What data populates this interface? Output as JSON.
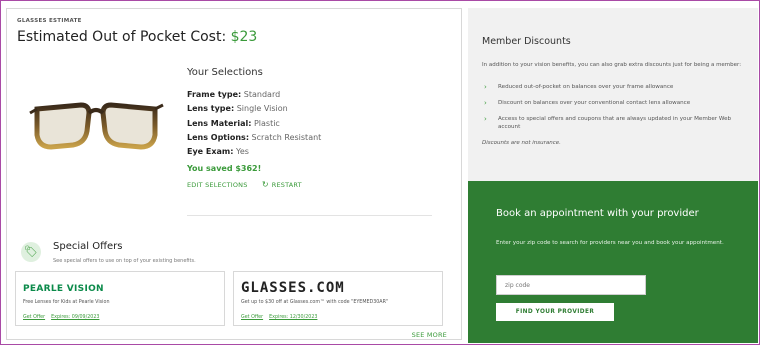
{
  "estimate": {
    "eyebrow": "GLASSES ESTIMATE",
    "title_prefix": "Estimated Out of Pocket Cost: ",
    "price": "$23"
  },
  "selections": {
    "title": "Your Selections",
    "rows": [
      {
        "key": "Frame type:",
        "value": " Standard"
      },
      {
        "key": "Lens type:",
        "value": " Single Vision"
      },
      {
        "key": "Lens Material:",
        "value": " Plastic"
      },
      {
        "key": "Lens Options:",
        "value": " Scratch Resistant"
      },
      {
        "key": "Eye Exam:",
        "value": " Yes"
      }
    ],
    "saved": "You saved $362!",
    "edit_label": "EDIT SELECTIONS",
    "restart_label": "RESTART"
  },
  "special_offers": {
    "title": "Special Offers",
    "subtitle": "See special offers to use on top of your existing benefits.",
    "offers": [
      {
        "brand": "PEARLE VISION",
        "description": "Free Lenses for Kids at Pearle Vision",
        "get_offer": "Get Offer",
        "expires": "Expires: 09/09/2023"
      },
      {
        "brand": "GLASSES.COM",
        "description": "Get up to $30 off at Glasses.com™ with code \"EYEMED30AR\"",
        "get_offer": "Get Offer",
        "expires": "Expires: 12/30/2023"
      }
    ],
    "see_more": "SEE MORE"
  },
  "member_discounts": {
    "title": "Member Discounts",
    "intro": "In addition to your vision benefits, you can also grab extra discounts just for being a member:",
    "items": [
      "Reduced out-of-pocket on balances over your frame allowance",
      "Discount on balances over your conventional contact lens allowance",
      "Access to special offers and coupons that are always updated in your Member Web account"
    ],
    "note": "Discounts are not insurance."
  },
  "appointment": {
    "title": "Book an appointment with your provider",
    "description": "Enter your zip code to search for providers near you and book your appointment.",
    "zip_placeholder": "zip code",
    "button": "FIND YOUR PROVIDER"
  },
  "colors": {
    "accent_green": "#3a9a3a",
    "panel_green": "#2f7d33",
    "frame_border": "#a94aa6"
  },
  "icons": [
    "glasses-image",
    "tag-icon",
    "restart-icon",
    "chevron-right-icon"
  ]
}
